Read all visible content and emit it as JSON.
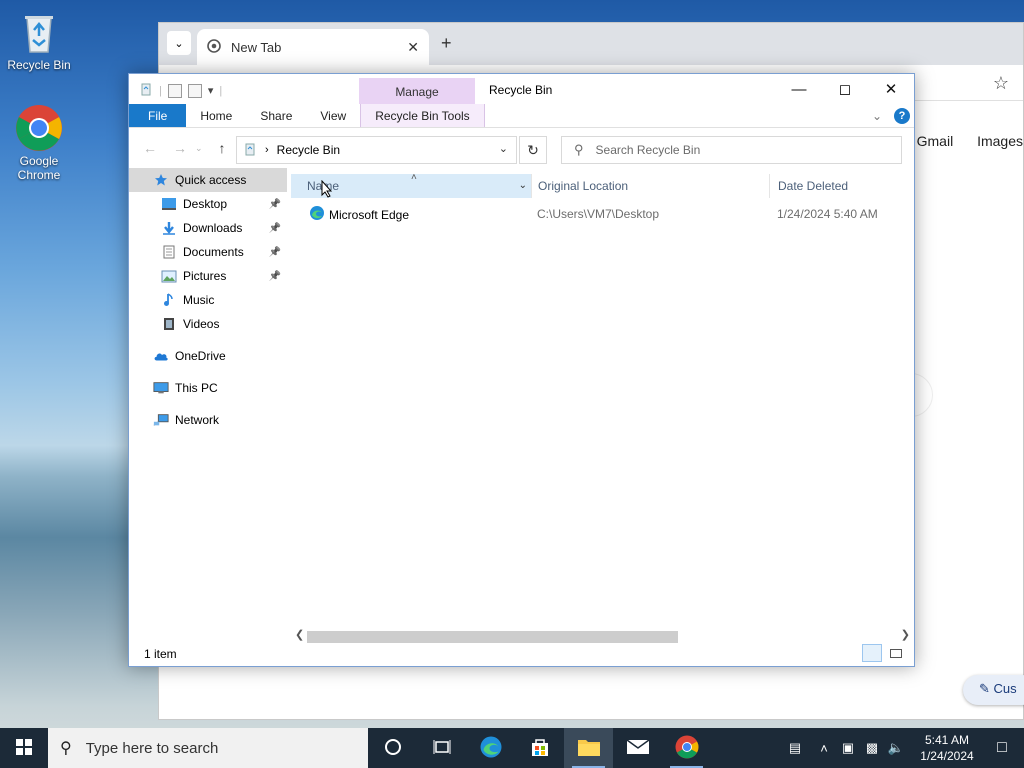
{
  "desktop": {
    "icons": [
      {
        "label": "Recycle Bin"
      },
      {
        "label": "Google Chrome"
      }
    ]
  },
  "chrome": {
    "tab_title": "New Tab",
    "new_tab_symbol": "+",
    "links": [
      "Gmail",
      "Images"
    ],
    "customize_label": "Cus"
  },
  "explorer": {
    "title": "Recycle Bin",
    "manage_tab": "Manage",
    "ribbon_tabs": [
      "File",
      "Home",
      "Share",
      "View",
      "Recycle Bin Tools"
    ],
    "address": "Recycle Bin",
    "search_placeholder": "Search Recycle Bin",
    "sidebar": [
      {
        "label": "Quick access",
        "icon": "star-icon",
        "selected": true,
        "indent": 0,
        "pinned": false
      },
      {
        "label": "Desktop",
        "icon": "desktop-icon",
        "indent": 1,
        "pinned": true
      },
      {
        "label": "Downloads",
        "icon": "downloads-icon",
        "indent": 1,
        "pinned": true
      },
      {
        "label": "Documents",
        "icon": "documents-icon",
        "indent": 1,
        "pinned": true
      },
      {
        "label": "Pictures",
        "icon": "pictures-icon",
        "indent": 1,
        "pinned": true
      },
      {
        "label": "Music",
        "icon": "music-icon",
        "indent": 1,
        "pinned": false
      },
      {
        "label": "Videos",
        "icon": "videos-icon",
        "indent": 1,
        "pinned": false
      },
      {
        "label": "OneDrive",
        "icon": "onedrive-icon",
        "indent": 0,
        "pinned": false
      },
      {
        "label": "This PC",
        "icon": "this-pc-icon",
        "indent": 0,
        "pinned": false
      },
      {
        "label": "Network",
        "icon": "network-icon",
        "indent": 0,
        "pinned": false
      }
    ],
    "columns": [
      "Name",
      "Original Location",
      "Date Deleted"
    ],
    "rows": [
      {
        "name": "Microsoft Edge",
        "original_location": "C:\\Users\\VM7\\Desktop",
        "date_deleted": "1/24/2024 5:40 AM"
      }
    ],
    "status": "1 item"
  },
  "taskbar": {
    "search_placeholder": "Type here to search",
    "time": "5:41 AM",
    "date": "1/24/2024"
  }
}
